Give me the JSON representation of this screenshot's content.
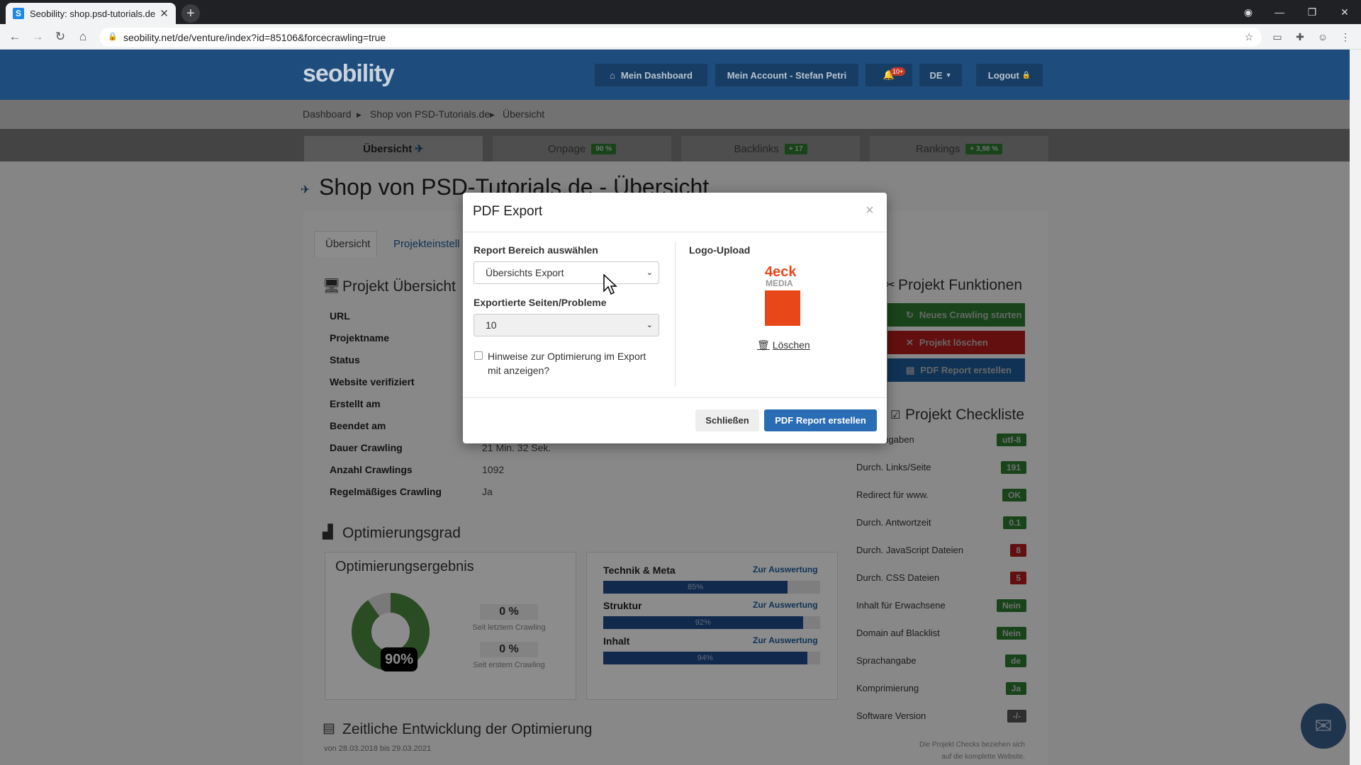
{
  "browser": {
    "tab_title": "Seobility: shop.psd-tutorials.de",
    "url": "seobility.net/de/venture/index?id=85106&forcecrawling=true"
  },
  "header": {
    "logo": "seobility",
    "dashboard": "Mein Dashboard",
    "account": "Mein Account - Stefan Petri",
    "notif_badge": "10+",
    "lang": "DE",
    "logout": "Logout"
  },
  "breadcrumb": [
    "Dashboard",
    "Shop von PSD-Tutorials.de",
    "Übersicht"
  ],
  "tabs": [
    {
      "label": "Übersicht",
      "badge": ""
    },
    {
      "label": "Onpage",
      "badge": "90 %"
    },
    {
      "label": "Backlinks",
      "badge": "+ 17"
    },
    {
      "label": "Rankings",
      "badge": "+ 3,98 %"
    }
  ],
  "page_title": "Shop von PSD-Tutorials.de - Übersicht",
  "subtabs": [
    "Übersicht",
    "Projekteinstell"
  ],
  "overview": {
    "title": "Projekt Übersicht",
    "rows": [
      {
        "k": "URL",
        "v": ""
      },
      {
        "k": "Projektname",
        "v": ""
      },
      {
        "k": "Status",
        "v": ""
      },
      {
        "k": "Website verifiziert",
        "v": ""
      },
      {
        "k": "Erstellt am",
        "v": ""
      },
      {
        "k": "Beendet am",
        "v": ""
      },
      {
        "k": "Dauer Crawling",
        "v": "21 Min. 32 Sek."
      },
      {
        "k": "Anzahl Crawlings",
        "v": "1092"
      },
      {
        "k": "Regelmäßiges Crawling",
        "v": "Ja"
      }
    ]
  },
  "optim": {
    "title": "Optimierungsgrad",
    "result_title": "Optimierungsergebnis",
    "score": "90%",
    "score_value": 0.9,
    "delta1": "0 %",
    "delta1_label": "Seit letztem Crawling",
    "delta2": "0 %",
    "delta2_label": "Seit erstem Crawling",
    "bars": [
      {
        "label": "Technik & Meta",
        "value": "85%",
        "fraction": 0.85,
        "link": "Zur Auswertung"
      },
      {
        "label": "Struktur",
        "value": "92%",
        "fraction": 0.92,
        "link": "Zur Auswertung"
      },
      {
        "label": "Inhalt",
        "value": "94%",
        "fraction": 0.94,
        "link": "Zur Auswertung"
      }
    ]
  },
  "timeline": {
    "title": "Zeitliche Entwicklung der Optimierung",
    "range": "von 28.03.2018 bis 29.03.2021"
  },
  "functions": {
    "title": "Projekt Funktionen",
    "new_crawl": "Neues Crawling starten",
    "delete": "Projekt löschen",
    "pdf": "PDF Report erstellen",
    "colors": {
      "green": "#2e7d32",
      "red": "#b71c1c",
      "blue": "#1e5d9c"
    }
  },
  "checklist": {
    "title": "Projekt Checkliste",
    "items": [
      {
        "label": "nsatzangaben",
        "val": "utf-8",
        "color": "#2e7d32"
      },
      {
        "label": "Durch. Links/Seite",
        "val": "191",
        "color": "#2e7d32"
      },
      {
        "label": "Redirect für www.",
        "val": "OK",
        "color": "#2e7d32"
      },
      {
        "label": "Durch. Antwortzeit",
        "val": "0.1",
        "color": "#2e7d32"
      },
      {
        "label": "Durch. JavaScript Dateien",
        "val": "8",
        "color": "#b71c1c"
      },
      {
        "label": "Durch. CSS Dateien",
        "val": "5",
        "color": "#b71c1c"
      },
      {
        "label": "Inhalt für Erwachsene",
        "val": "Nein",
        "color": "#2e7d32"
      },
      {
        "label": "Domain auf Blacklist",
        "val": "Nein",
        "color": "#2e7d32"
      },
      {
        "label": "Sprachangabe",
        "val": "de",
        "color": "#2e7d32"
      },
      {
        "label": "Komprimierung",
        "val": "Ja",
        "color": "#2e7d32"
      },
      {
        "label": "Software Version",
        "val": "-/-",
        "color": "#555555"
      }
    ],
    "note1": "Die Projekt Checks beziehen sich",
    "note2": "auf die komplette Website."
  },
  "modal": {
    "title": "PDF Export",
    "close": "×",
    "section_label": "Report Bereich auswählen",
    "section_value": "Übersichts Export",
    "pages_label": "Exportierte Seiten/Probleme",
    "pages_value": "10",
    "hint_line1": "Hinweise zur Optimierung im Export",
    "hint_line2": "mit anzeigen?",
    "logo_label": "Logo-Upload",
    "logo_text1": "4eck",
    "logo_text2": "MEDIA",
    "delete": "Löschen",
    "close_btn": "Schließen",
    "create_btn": "PDF Report erstellen"
  }
}
